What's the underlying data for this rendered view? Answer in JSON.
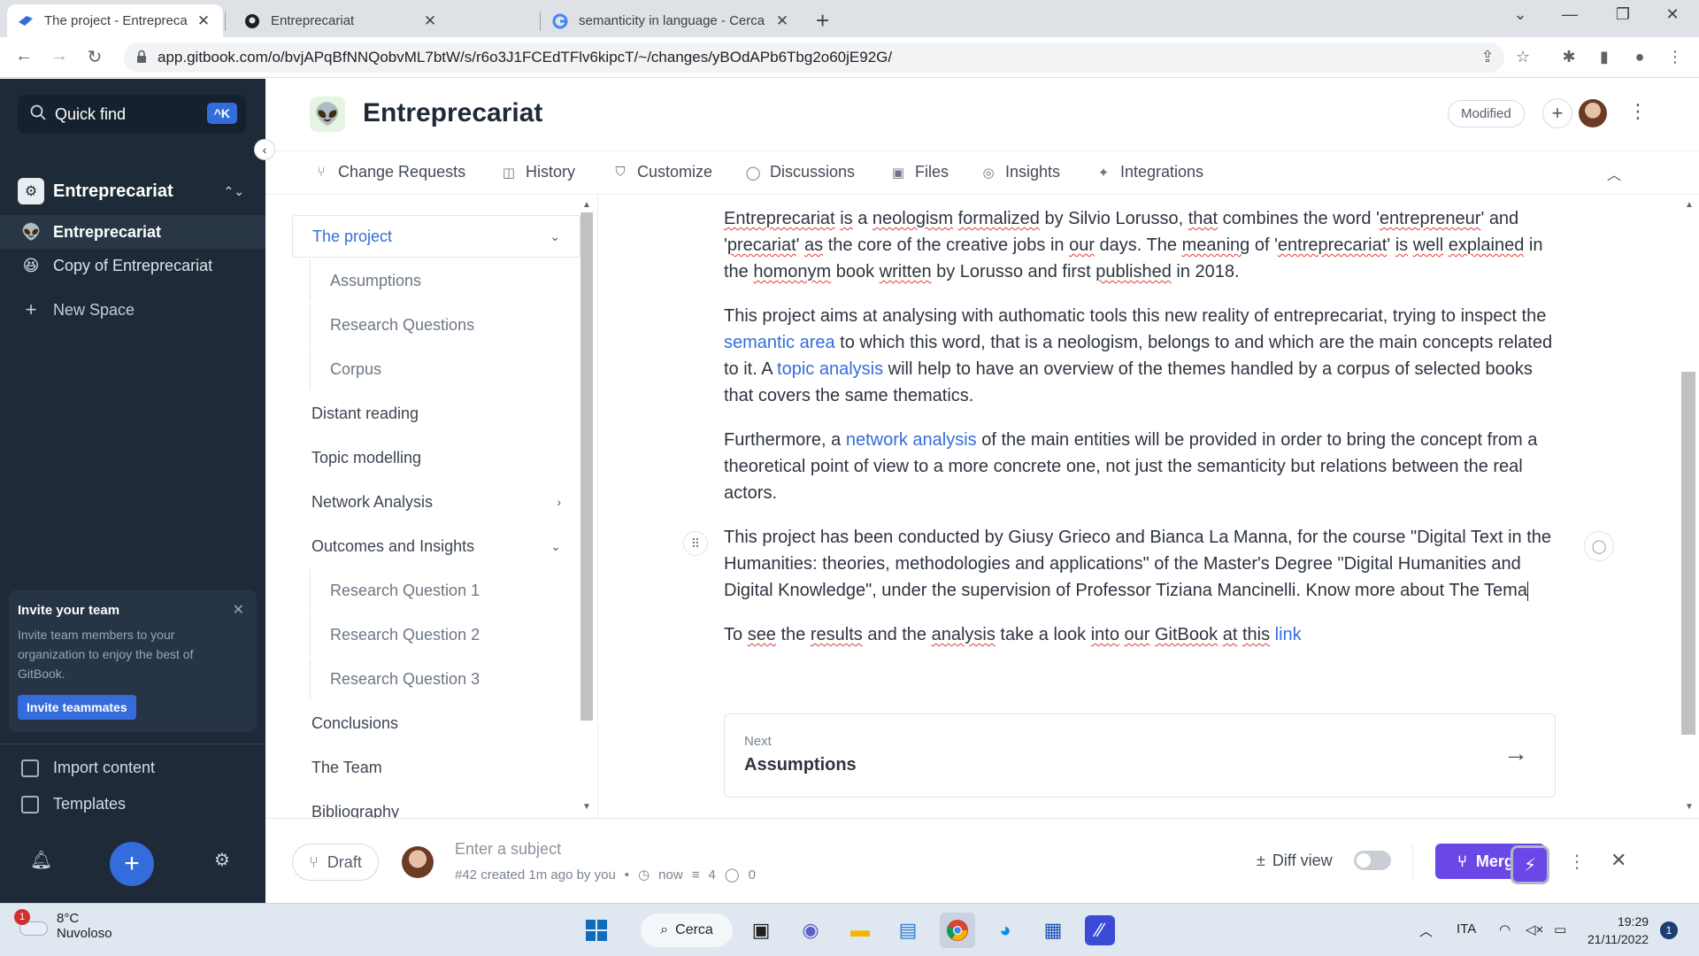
{
  "browser": {
    "tabs": [
      {
        "title": "The project - Entreprecariat",
        "favicon": "gitbook-icon",
        "active": true
      },
      {
        "title": "Entreprecariat",
        "favicon": "github-icon",
        "active": false
      },
      {
        "title": "semanticity in language - Cerca c",
        "favicon": "google-icon",
        "active": false
      }
    ],
    "url": "app.gitbook.com/o/bvjAPqBfNNQobvML7btW/s/r6o3J1FCEdTFlv6kipcT/~/changes/yBOdAPb6Tbg2o60jE92G/"
  },
  "sidebar": {
    "quick_find": "Quick find",
    "shortcut": "^K",
    "org_name": "Entreprecariat",
    "spaces": [
      {
        "label": "Entreprecariat",
        "emoji": "alien",
        "active": true
      },
      {
        "label": "Copy of Entreprecariat",
        "emoji": "grin",
        "active": false
      }
    ],
    "new_space": "New Space",
    "invite": {
      "title": "Invite your team",
      "body": "Invite team members to your organization to enjoy the best of GitBook.",
      "button": "Invite teammates"
    },
    "import_content": "Import content",
    "templates": "Templates"
  },
  "header": {
    "title": "Entreprecariat",
    "status": "Modified"
  },
  "nav": {
    "items": [
      "Change Requests",
      "History",
      "Customize",
      "Discussions",
      "Files",
      "Insights",
      "Integrations"
    ]
  },
  "toc": {
    "items": [
      {
        "label": "The project",
        "level": 0,
        "selected": true,
        "chevron": "down"
      },
      {
        "label": "Assumptions",
        "level": 1
      },
      {
        "label": "Research Questions",
        "level": 1
      },
      {
        "label": "Corpus",
        "level": 1
      },
      {
        "label": "Distant reading",
        "level": 0
      },
      {
        "label": "Topic modelling",
        "level": 0
      },
      {
        "label": "Network Analysis",
        "level": 0,
        "chevron": "right"
      },
      {
        "label": "Outcomes and Insights",
        "level": 0,
        "chevron": "down"
      },
      {
        "label": "Research Question 1",
        "level": 1
      },
      {
        "label": "Research Question 2",
        "level": 1
      },
      {
        "label": "Research Question 3",
        "level": 1
      },
      {
        "label": "Conclusions",
        "level": 0
      },
      {
        "label": "The Team",
        "level": 0
      },
      {
        "label": "Bibliography",
        "level": 0
      }
    ]
  },
  "content": {
    "p1": {
      "w1": "Entreprecariat",
      "w2": "is",
      "w3": "a",
      "w4": "neologism",
      "w5": "formalized",
      "t1": " by Silvio Lorusso, ",
      "w6": "that",
      "t2": " combines the word '",
      "w7": "entrepreneur",
      "t3": "' and '",
      "w8": "precariat",
      "t4": "' ",
      "w9": "as",
      "t5": " the core of the creative jobs in ",
      "w10": "our",
      "t6": " days. The ",
      "w11": "meaning",
      "t7": " of '",
      "w12": "entreprecariat",
      "t8": "' ",
      "w13": "is",
      "t9": " ",
      "w14": "well",
      "t10": " ",
      "w15": "explained",
      "t11": " in the ",
      "w16": "homonym",
      "t12": " book ",
      "w17": "written",
      "t13": " by Lorusso and first ",
      "w18": "published",
      "t14": " in 2018."
    },
    "p2": {
      "a": "This project aims at analysing with authomatic tools this new reality of entreprecariat, trying to inspect the ",
      "link1": "semantic area",
      "b": " to which this word, that is a neologism, belongs to and which are the main concepts related to it. A ",
      "link2": "topic analysis",
      "c": " will help to have an overview of the themes handled by a corpus of selected books that covers the same thematics."
    },
    "p3": {
      "a": "Furthermore, a ",
      "link": "network analysis",
      "b": " of the main entities will be provided in order to bring the concept from a theoretical point of view to a more concrete one, not just the semanticity but relations between the real actors."
    },
    "p4": "This project has been conducted by Giusy Grieco and Bianca La Manna, for the course \"Digital Text in the Humanities: theories, methodologies and applications\" of the Master's Degree \"Digital Humanities and Digital Knowledge\", under the supervision of Professor Tiziana Mancinelli. Know more about The Tema",
    "p5": {
      "t1": "To ",
      "w1": "see",
      "t2": " the ",
      "w2": "results",
      "t3": " and the ",
      "w3": "analysis",
      "t4": " take a look ",
      "w4": "into",
      "t5": " ",
      "w5": "our",
      "t6": " ",
      "w6": "GitBook",
      "t7": " ",
      "w7": "at",
      "t8": " ",
      "w8": "this",
      "t9": " ",
      "link": "link"
    },
    "next_label": "Next",
    "next_title": "Assumptions"
  },
  "bottom": {
    "draft": "Draft",
    "subject_placeholder": "Enter a subject",
    "meta": "#42 created 1m ago by you",
    "time": "now",
    "changes": "4",
    "comments": "0",
    "diff_view": "Diff view",
    "merge": "Merge"
  },
  "taskbar": {
    "temp": "8°C",
    "weather": "Nuvoloso",
    "weather_badge": "1",
    "search": "Cerca",
    "lang": "ITA",
    "time": "19:29",
    "date": "21/11/2022",
    "notifications": "1"
  },
  "colors": {
    "sidebar_bg": "#1e2a38",
    "accent": "#346ddb",
    "merge": "#6a48e8"
  }
}
